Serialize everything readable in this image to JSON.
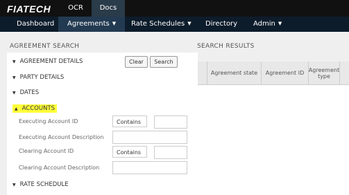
{
  "app": {
    "logo": "FIATECH"
  },
  "product_tabs": [
    {
      "label": "OCR",
      "active": false
    },
    {
      "label": "Docs",
      "active": true
    }
  ],
  "nav": {
    "items": [
      {
        "label": "Dashboard",
        "has_menu": false
      },
      {
        "label": "Agreements",
        "has_menu": true,
        "active": true
      },
      {
        "label": "Rate Schedules",
        "has_menu": true
      },
      {
        "label": "Directory",
        "has_menu": false
      },
      {
        "label": "Admin",
        "has_menu": true
      }
    ],
    "caret": "▼"
  },
  "search": {
    "title": "AGREEMENT SEARCH",
    "clear_label": "Clear",
    "search_label": "Search",
    "sections": {
      "agreement_details": "AGREEMENT DETAILS",
      "party_details": "PARTY DETAILS",
      "dates": "DATES",
      "accounts": "ACCOUNTS",
      "rate_schedule": "RATE SCHEDULE"
    },
    "collapsed_marker": "▼",
    "expanded_marker": "▲",
    "fields": {
      "executing_account_id": {
        "label": "Executing Account ID",
        "operator": "Contains",
        "value": ""
      },
      "executing_account_description": {
        "label": "Executing Account Description",
        "value": ""
      },
      "clearing_account_id": {
        "label": "Clearing Account ID",
        "operator": "Contains",
        "value": ""
      },
      "clearing_account_description": {
        "label": "Clearing Account Description",
        "value": ""
      }
    },
    "highlight_color": "#ffff3a"
  },
  "results": {
    "title": "SEARCH RESULTS",
    "columns": [
      "Agreement state",
      "Agreement ID",
      "Agreement type"
    ]
  },
  "colors": {
    "topbar": "#111111",
    "navbar": "#0d1c2b",
    "nav_active": "#233b52"
  }
}
